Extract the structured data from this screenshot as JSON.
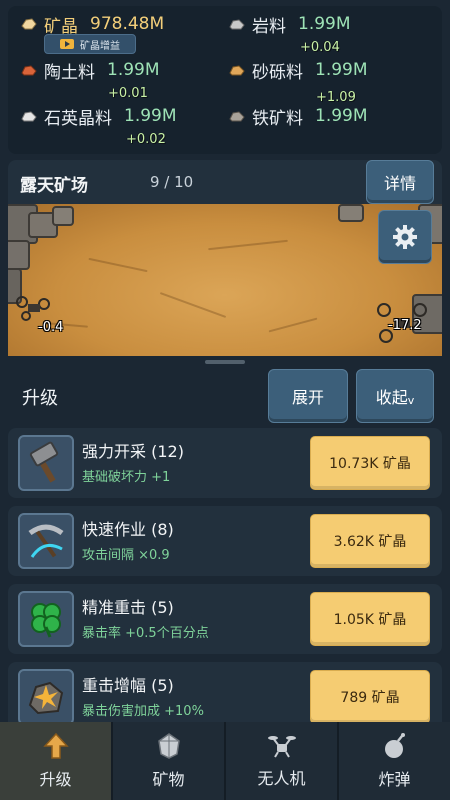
{
  "resources": {
    "boost_label": "矿晶增益",
    "items": [
      {
        "name": "矿晶",
        "value": "978.48M",
        "icon": "crystal-icon"
      },
      {
        "name": "岩料",
        "value": "1.99M",
        "icon": "rock-ore-icon"
      },
      {
        "name": "陶土料",
        "value": "1.99M",
        "icon": "clay-ore-icon"
      },
      {
        "name": "砂砾料",
        "value": "1.99M",
        "icon": "gravel-ore-icon"
      },
      {
        "name": "石英晶料",
        "value": "1.99M",
        "icon": "quartz-ore-icon"
      },
      {
        "name": "铁矿料",
        "value": "1.99M",
        "icon": "iron-ore-icon"
      }
    ],
    "deltas": [
      "+0.04",
      "+0.01",
      "+1.09",
      "+0.02"
    ]
  },
  "mine": {
    "title": "露天矿场",
    "count": "9 / 10",
    "details_label": "详情",
    "left_number": "-0.4",
    "right_number": "-17.2"
  },
  "upgrades": {
    "title": "升级",
    "expand_label": "展开",
    "collapse_label": "收起",
    "collapse_suffix": "v",
    "items": [
      {
        "name": "强力开采 (12)",
        "desc": "基础破坏力 +1",
        "price": "10.73K 矿晶",
        "icon": "hammer-icon"
      },
      {
        "name": "快速作业 (8)",
        "desc": "攻击间隔 ×0.9",
        "price": "3.62K 矿晶",
        "icon": "pickaxe-icon"
      },
      {
        "name": "精准重击 (5)",
        "desc": "暴击率 +0.5个百分点",
        "price": "1.05K 矿晶",
        "icon": "clover-icon"
      },
      {
        "name": "重击增幅 (5)",
        "desc": "暴击伤害加成 +10%",
        "price": "789 矿晶",
        "icon": "rock-burst-icon"
      }
    ]
  },
  "nav": {
    "tabs": [
      {
        "label": "升级",
        "icon": "arrow-up-icon",
        "active": true
      },
      {
        "label": "矿物",
        "icon": "mineral-icon",
        "active": false
      },
      {
        "label": "无人机",
        "icon": "drone-icon",
        "active": false
      },
      {
        "label": "炸弹",
        "icon": "bomb-icon",
        "active": false
      }
    ]
  }
}
